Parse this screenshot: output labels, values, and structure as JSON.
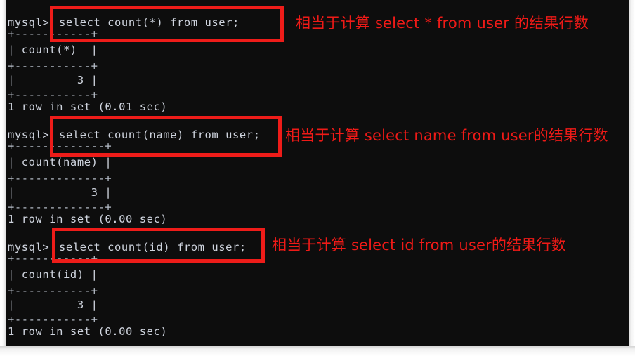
{
  "terminal": {
    "prompt": "mysql>",
    "blocks": [
      {
        "prompt": "mysql>",
        "query": "select count(*) from user;",
        "divider_top": "+-----------+",
        "header": "| count(*)  |",
        "divider_mid": "+-----------+",
        "value_row": "|         3 |",
        "divider_bottom": "+-----------+",
        "status": "1 row in set (0.01 sec)",
        "annotation": "相当于计算 select * from user 的结果行数"
      },
      {
        "prompt": "mysql>",
        "query": "select count(name) from user;",
        "divider_top": "+-------------+",
        "header": "| count(name) |",
        "divider_mid": "+-------------+",
        "value_row": "|           3 |",
        "divider_bottom": "+-------------+",
        "status": "1 row in set (0.00 sec)",
        "annotation": "相当于计算 select name from user的结果行数"
      },
      {
        "prompt": "mysql>",
        "query": "select count(id) from user;",
        "divider_top": "+-----------+",
        "header": "| count(id) |",
        "divider_mid": "+-----------+",
        "value_row": "|         3 |",
        "divider_bottom": "+-----------+",
        "status": "1 row in set (0.00 sec)",
        "annotation": "相当于计算 select id from user的结果行数"
      }
    ]
  },
  "colors": {
    "annotation_red": "#ef1a17",
    "box_red": "#ee1c19",
    "terminal_background": "#0d0d0d",
    "terminal_text": "#cfd4de"
  }
}
